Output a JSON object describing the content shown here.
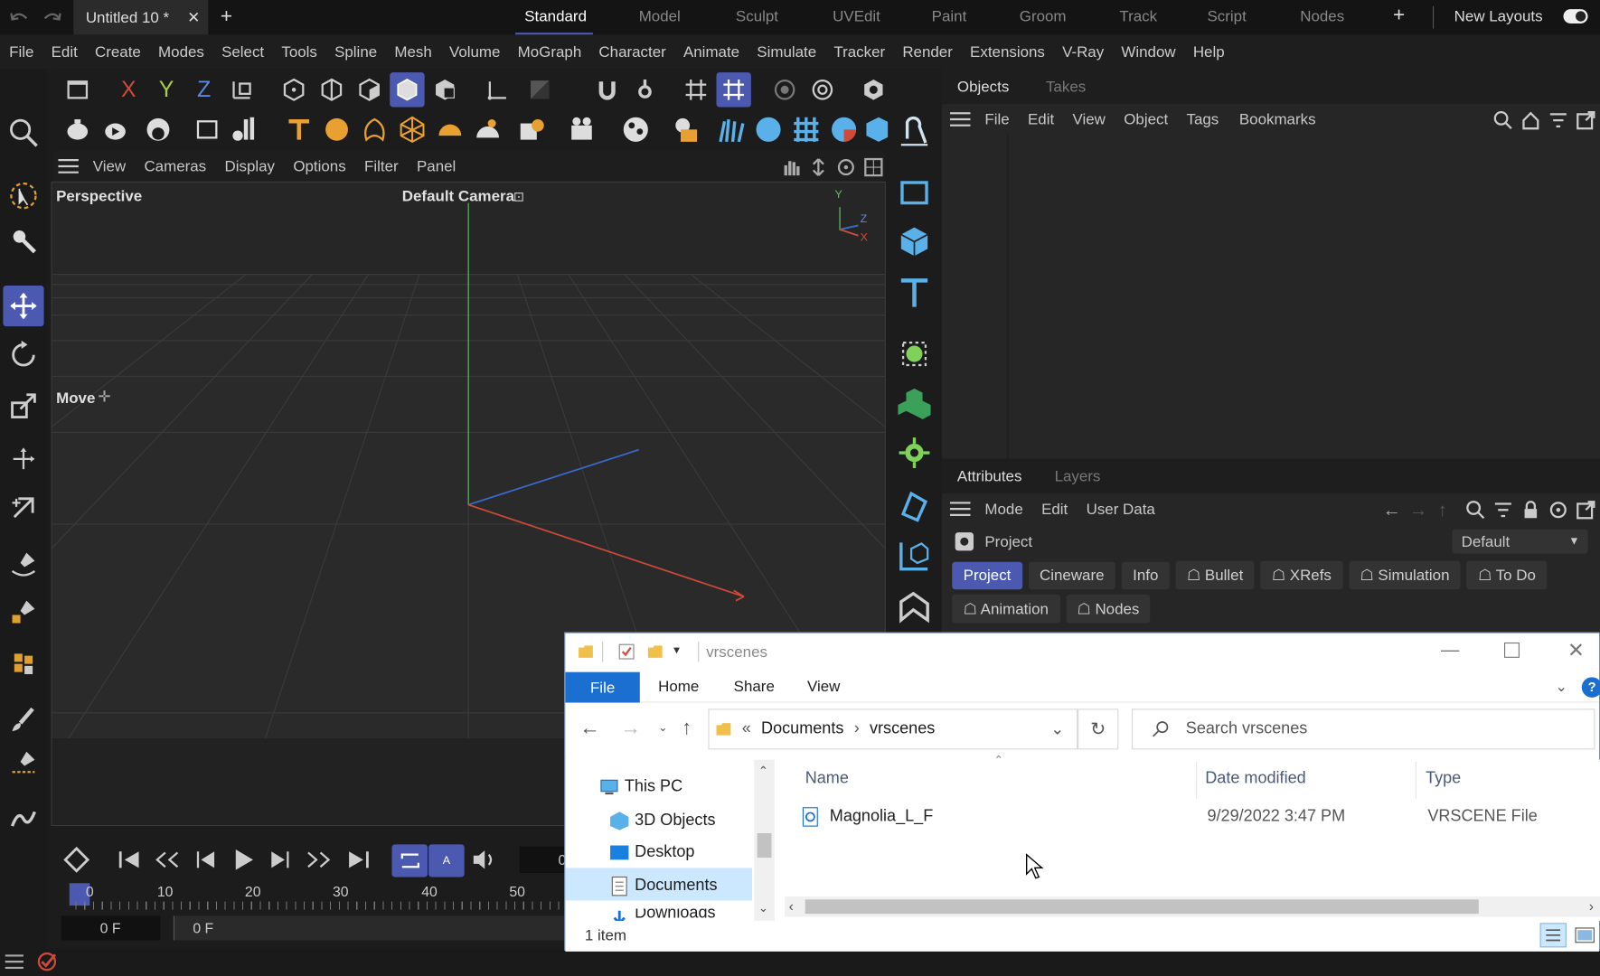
{
  "top_bar": {
    "tab_title": "Untitled 10 *",
    "layouts": [
      "Standard",
      "Model",
      "Sculpt",
      "UVEdit",
      "Paint",
      "Groom",
      "Track",
      "Script",
      "Nodes"
    ],
    "active_layout": "Standard",
    "new_layouts": "New Layouts"
  },
  "menu": [
    "File",
    "Edit",
    "Create",
    "Modes",
    "Select",
    "Tools",
    "Spline",
    "Mesh",
    "Volume",
    "MoGraph",
    "Character",
    "Animate",
    "Simulate",
    "Tracker",
    "Render",
    "Extensions",
    "V-Ray",
    "Window",
    "Help"
  ],
  "axis_buttons": {
    "x": "X",
    "y": "Y",
    "z": "Z"
  },
  "viewport": {
    "menu": [
      "View",
      "Cameras",
      "Display",
      "Options",
      "Filter",
      "Panel"
    ],
    "label": "Perspective",
    "camera": "Default Camera",
    "tool_label": "Move",
    "axis_y": "Y",
    "axis_z": "Z",
    "axis_x": "X"
  },
  "objects_panel": {
    "tabs": [
      "Objects",
      "Takes"
    ],
    "menu": [
      "File",
      "Edit",
      "View",
      "Object",
      "Tags",
      "Bookmarks"
    ]
  },
  "attributes_panel": {
    "tabs": [
      "Attributes",
      "Layers"
    ],
    "menu": [
      "Mode",
      "Edit",
      "User Data"
    ],
    "project_label": "Project",
    "preset": "Default",
    "pills_row1": [
      "Project",
      "Cineware",
      "Info",
      "Bullet",
      "XRefs",
      "Simulation",
      "To Do"
    ],
    "pills_row2": [
      "Animation",
      "Nodes"
    ]
  },
  "timeline": {
    "ticks": [
      "0",
      "10",
      "20",
      "30",
      "40",
      "50"
    ],
    "frame_current": "0 F",
    "frame_start": "0 F",
    "frame_partial": "0"
  },
  "explorer": {
    "title": "vrscenes",
    "ribbon": [
      "File",
      "Home",
      "Share",
      "View"
    ],
    "breadcrumb": [
      "Documents",
      "vrscenes"
    ],
    "search_placeholder": "Search vrscenes",
    "nav": [
      "This PC",
      "3D Objects",
      "Desktop",
      "Documents",
      "Downloads"
    ],
    "columns": [
      "Name",
      "Date modified",
      "Type"
    ],
    "files": [
      {
        "name": "Magnolia_L_F",
        "date": "9/29/2022 3:47 PM",
        "type": "VRSCENE File"
      }
    ],
    "status": "1 item"
  },
  "colors": {
    "accent": "#4c59b0",
    "x_axis": "#d04a3a",
    "y_axis": "#4ec24e",
    "z_axis": "#3a6bd0",
    "explorer_blue": "#1a6fd0"
  }
}
